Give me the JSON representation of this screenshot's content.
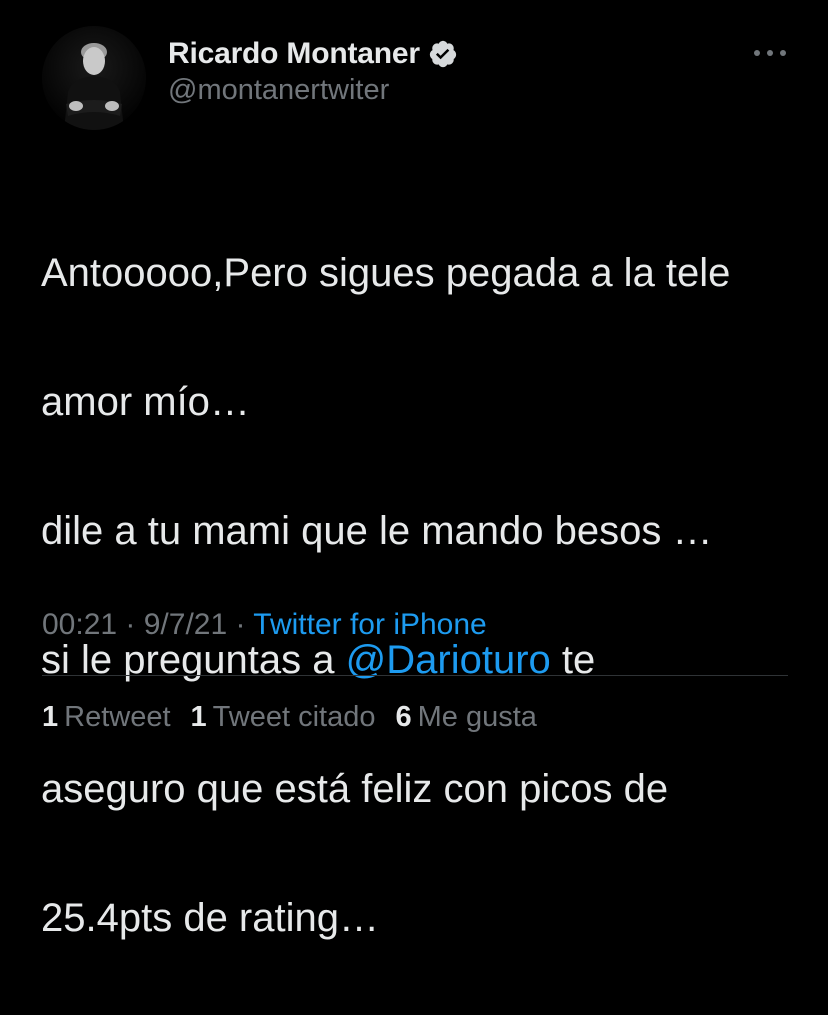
{
  "author": {
    "display_name": "Ricardo Montaner",
    "handle": "@montanertwiter",
    "verified": true,
    "avatar": "profile-photo"
  },
  "tweet": {
    "lines": [
      {
        "before": "Antooooo,Pero sigues pegada a la tele"
      },
      {
        "before": "amor mío…"
      },
      {
        "before": "dile a tu mami que le mando besos …"
      },
      {
        "before": "si le preguntas a ",
        "mention": "@Darioturo",
        "after": " te"
      },
      {
        "before": "aseguro que está feliz con picos de"
      },
      {
        "before": "25.4pts de rating…"
      }
    ]
  },
  "meta": {
    "time": "00:21",
    "separator": " · ",
    "date": "9/7/21",
    "source": "Twitter for iPhone"
  },
  "stats": [
    {
      "count": "1",
      "label": "Retweet"
    },
    {
      "count": "1",
      "label": "Tweet citado"
    },
    {
      "count": "6",
      "label": "Me gusta"
    }
  ],
  "colors": {
    "background": "#000000",
    "text": "#e7e9ea",
    "secondary": "#71767b",
    "link": "#1d9bf0"
  },
  "icons": {
    "verified": "verified-badge-icon",
    "more": "more-horizontal-icon"
  }
}
